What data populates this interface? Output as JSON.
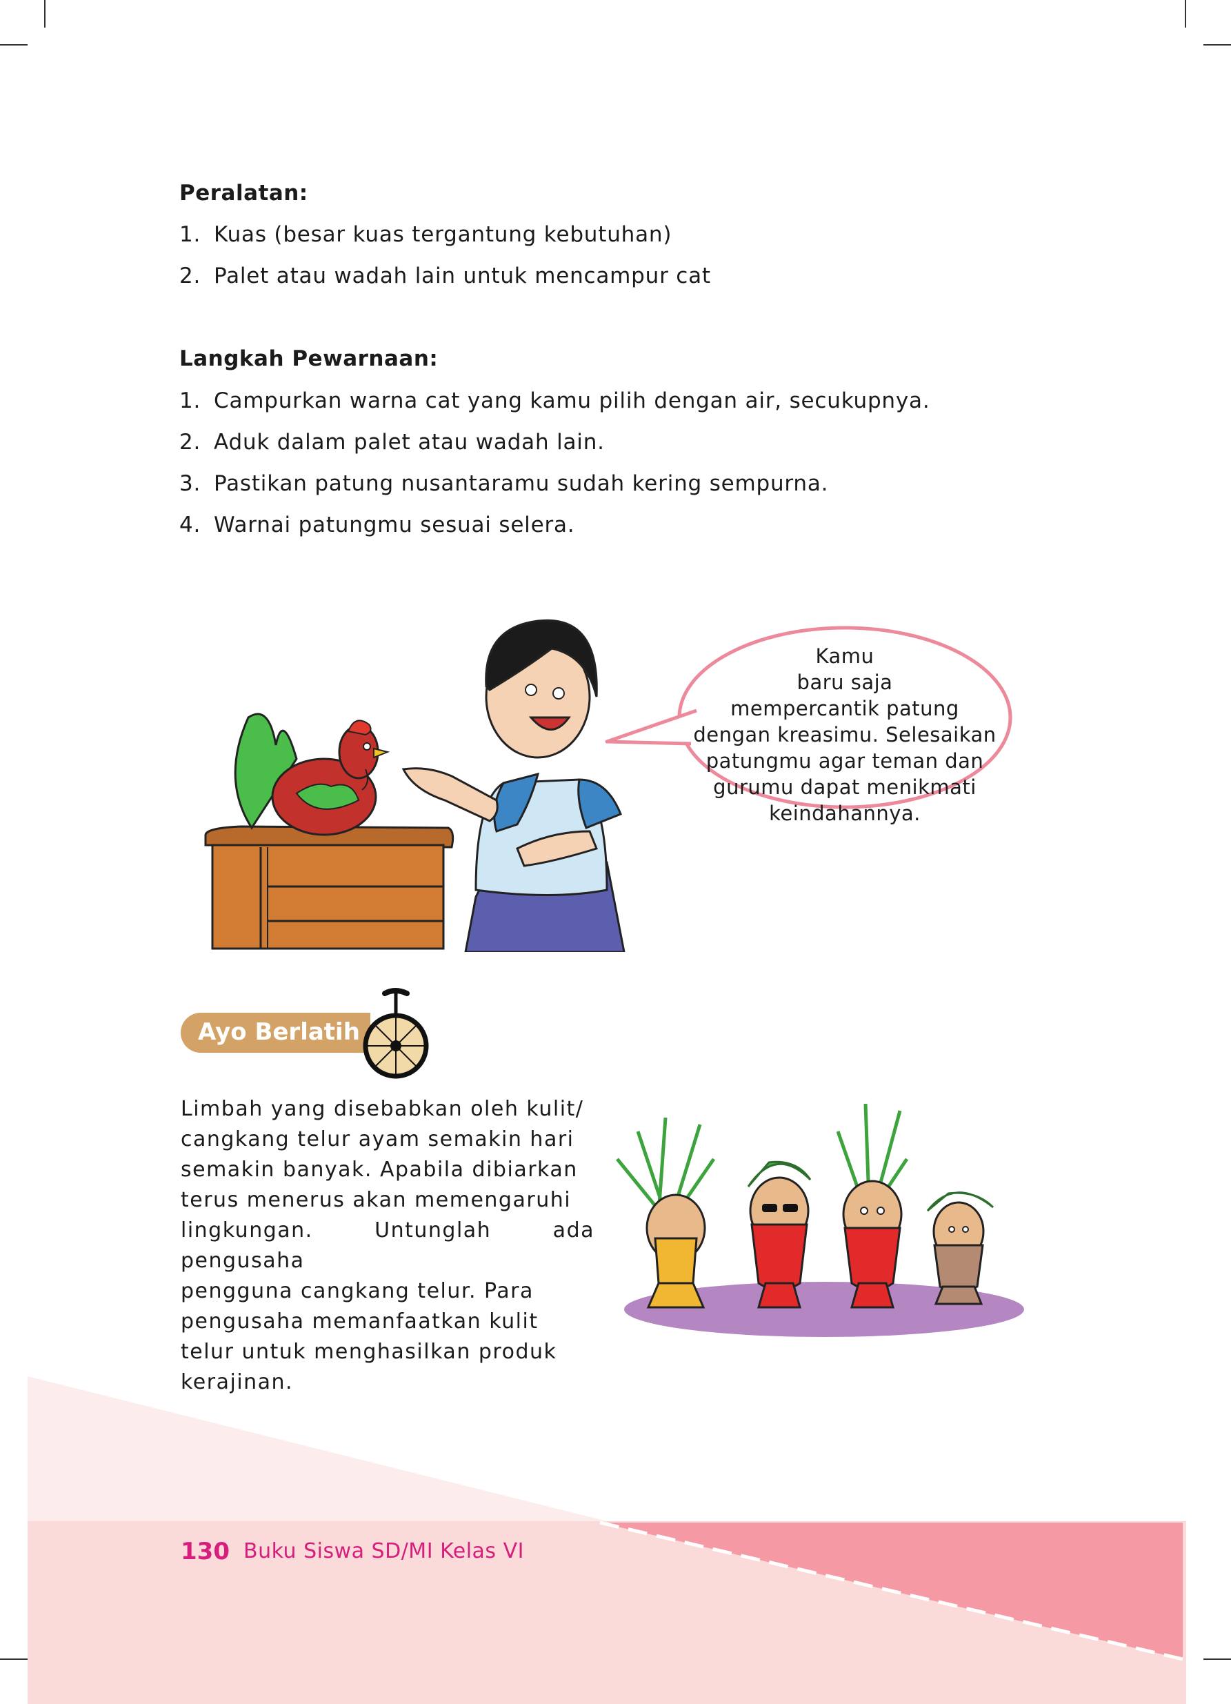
{
  "peralatan": {
    "heading": "Peralatan:",
    "items": [
      {
        "num": "1.",
        "text": "Kuas (besar kuas tergantung kebutuhan)"
      },
      {
        "num": "2.",
        "text": "Palet atau wadah lain untuk mencampur cat"
      }
    ]
  },
  "langkah": {
    "heading": "Langkah Pewarnaan:",
    "items": [
      {
        "num": "1.",
        "text": "Campurkan warna cat yang kamu pilih dengan air, secukupnya."
      },
      {
        "num": "2.",
        "text": "Aduk dalam palet atau wadah lain."
      },
      {
        "num": "3.",
        "text": "Pastikan patung nusantaramu sudah kering sempurna."
      },
      {
        "num": "4.",
        "text": "Warnai patungmu sesuai selera."
      }
    ]
  },
  "speech_bubble": {
    "lines": [
      "Kamu",
      "baru saja",
      "mempercantik patung",
      "dengan kreasimu. Selesaikan",
      "patungmu agar teman dan",
      "gurumu dapat menikmati",
      "keindahannya."
    ]
  },
  "exercise": {
    "badge": "Ayo Berlatih",
    "paragraph_lines": [
      "Limbah yang disebabkan oleh kulit/",
      "cangkang telur ayam semakin hari",
      "semakin banyak. Apabila dibiarkan",
      "terus menerus akan memengaruhi",
      "lingkungan. Untunglah ada pengusaha",
      "pengguna cangkang telur. Para",
      "pengusaha memanfaatkan kulit",
      "telur untuk menghasilkan produk",
      "kerajinan."
    ]
  },
  "footer": {
    "page_number": "130",
    "book_title": "Buku Siswa SD/MI Kelas VI"
  },
  "colors": {
    "accent_pink": "#d61f7c",
    "badge_tan": "#d2a266",
    "band_pink": "#f59aa5",
    "band_light": "#fbdada"
  }
}
